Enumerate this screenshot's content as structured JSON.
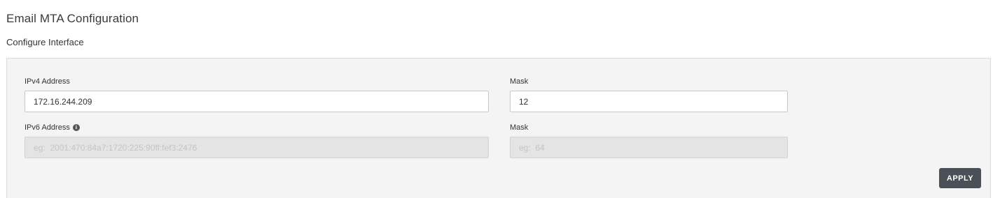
{
  "header": {
    "title": "Email MTA Configuration",
    "section_title": "Configure Interface"
  },
  "form": {
    "ipv4": {
      "label": "IPv4 Address",
      "value": "172.16.244.209",
      "mask_label": "Mask",
      "mask_value": "12"
    },
    "ipv6": {
      "label": "IPv6 Address",
      "info_icon": "info-circle-icon",
      "placeholder": "eg:  2001:470:84a7:1720:225:90ff:fef3:2476",
      "mask_label": "Mask",
      "mask_placeholder": "eg:  64"
    },
    "apply_label": "APPLY"
  }
}
